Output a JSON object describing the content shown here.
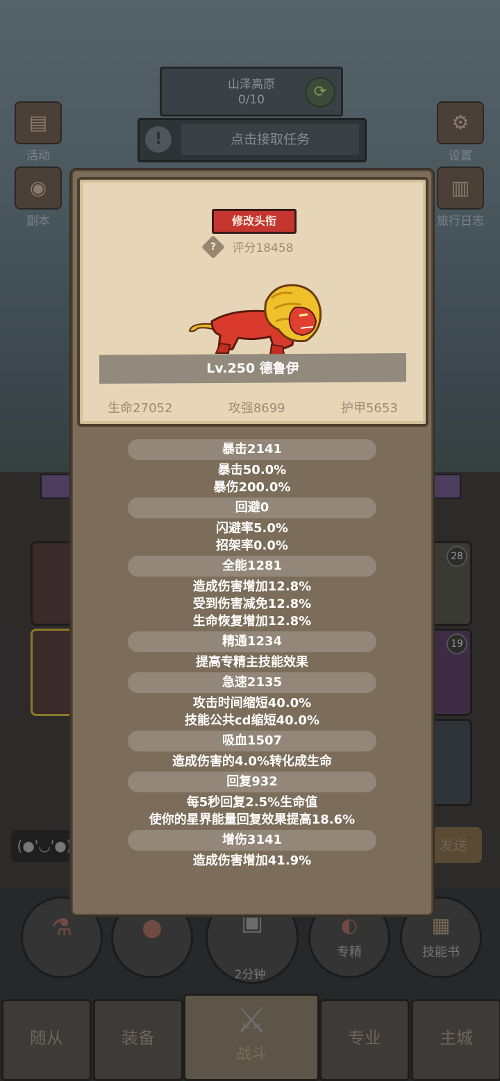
{
  "background": {
    "zone": {
      "name": "山泽高原",
      "progress": "0/10"
    },
    "task_prompt": "点击接取任务",
    "left_buttons": [
      {
        "label": "活动",
        "icon": "scroll-icon"
      },
      {
        "label": "副本",
        "icon": "dungeon-icon"
      }
    ],
    "right_buttons": [
      {
        "label": "设置",
        "icon": "gear-icon"
      },
      {
        "label": "旅行日志",
        "icon": "journal-icon"
      }
    ],
    "card_badges": [
      "28",
      "19"
    ],
    "chat_emoji": "(●'◡'●)",
    "send_label": "发送",
    "action_buttons": [
      {
        "label": "",
        "icon": "potion-icon"
      },
      {
        "label": "",
        "icon": "bread-icon"
      },
      {
        "label": "专精",
        "icon": "specialize-icon"
      },
      {
        "label": "技能书",
        "icon": "skillbook-icon"
      }
    ],
    "chest_timer": "2分钟",
    "tabs": [
      "随从",
      "装备",
      "战斗",
      "专业",
      "主城"
    ],
    "active_tab": "战斗"
  },
  "panel": {
    "title_button": "修改头衔",
    "score": "评分18458",
    "pet_name": "Lv.250 德鲁伊",
    "base_stats": [
      "生命27052",
      "攻强8699",
      "护甲5653"
    ],
    "groups": [
      {
        "header": "暴击2141",
        "lines": [
          "暴击50.0%",
          "暴伤200.0%"
        ]
      },
      {
        "header": "回避0",
        "lines": [
          "闪避率5.0%",
          "招架率0.0%"
        ]
      },
      {
        "header": "全能1281",
        "lines": [
          "造成伤害增加12.8%",
          "受到伤害减免12.8%",
          "生命恢复增加12.8%"
        ]
      },
      {
        "header": "精通1234",
        "lines": [
          "提高专精主技能效果"
        ]
      },
      {
        "header": "急速2135",
        "lines": [
          "攻击时间缩短40.0%",
          "技能公共cd缩短40.0%"
        ]
      },
      {
        "header": "吸血1507",
        "lines": [
          "造成伤害的4.0%转化成生命"
        ]
      },
      {
        "header": "回复932",
        "lines": [
          "每5秒回复2.5%生命值",
          "使你的星界能量回复效果提高18.6%"
        ]
      },
      {
        "header": "增伤3141",
        "lines": [
          "造成伤害增加41.9%"
        ]
      }
    ]
  },
  "colors": {
    "accent_red": "#c53630",
    "paper": "#e6d6b7",
    "panel": "#7b6d5a"
  }
}
